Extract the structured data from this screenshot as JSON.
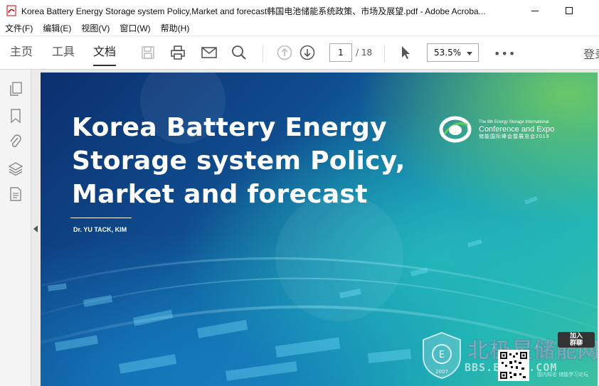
{
  "window": {
    "title": "Korea Battery Energy Storage system Policy,Market and forecast韩国电池储能系统政策、市场及展望.pdf - Adobe Acroba..."
  },
  "menu": {
    "items": [
      {
        "label": "文件(F)"
      },
      {
        "label": "编辑(E)"
      },
      {
        "label": "视图(V)"
      },
      {
        "label": "窗口(W)"
      },
      {
        "label": "帮助(H)"
      }
    ]
  },
  "toolbar": {
    "tabs": [
      {
        "label": "主页",
        "active": false
      },
      {
        "label": "工具",
        "active": false
      },
      {
        "label": "文档",
        "active": true
      }
    ],
    "page_current": "1",
    "page_total": "/ 18",
    "zoom": "53.5%",
    "more": "•••",
    "signin": "登录"
  },
  "slide": {
    "title_lines": [
      "Korea Battery Energy",
      "Storage system Policy,",
      "Market and forecast"
    ],
    "author": "Dr. YU TACK, KIM",
    "conference": {
      "line1": "The 8th Energy Storage International",
      "line2": "Conference and Expo",
      "line3": "储能国际峰会暨展览会2019"
    }
  },
  "watermark": {
    "text": "北极星储能网",
    "url": "BBS.ESSPV.COM",
    "join_badge": "加入\n群聊",
    "small": "国内知名 储能学习论坛",
    "shield_year": "2007"
  },
  "colors": {
    "accent": "#0f4d8f",
    "slide_teal": "#1fb3b0",
    "slide_green": "#78d25a"
  }
}
